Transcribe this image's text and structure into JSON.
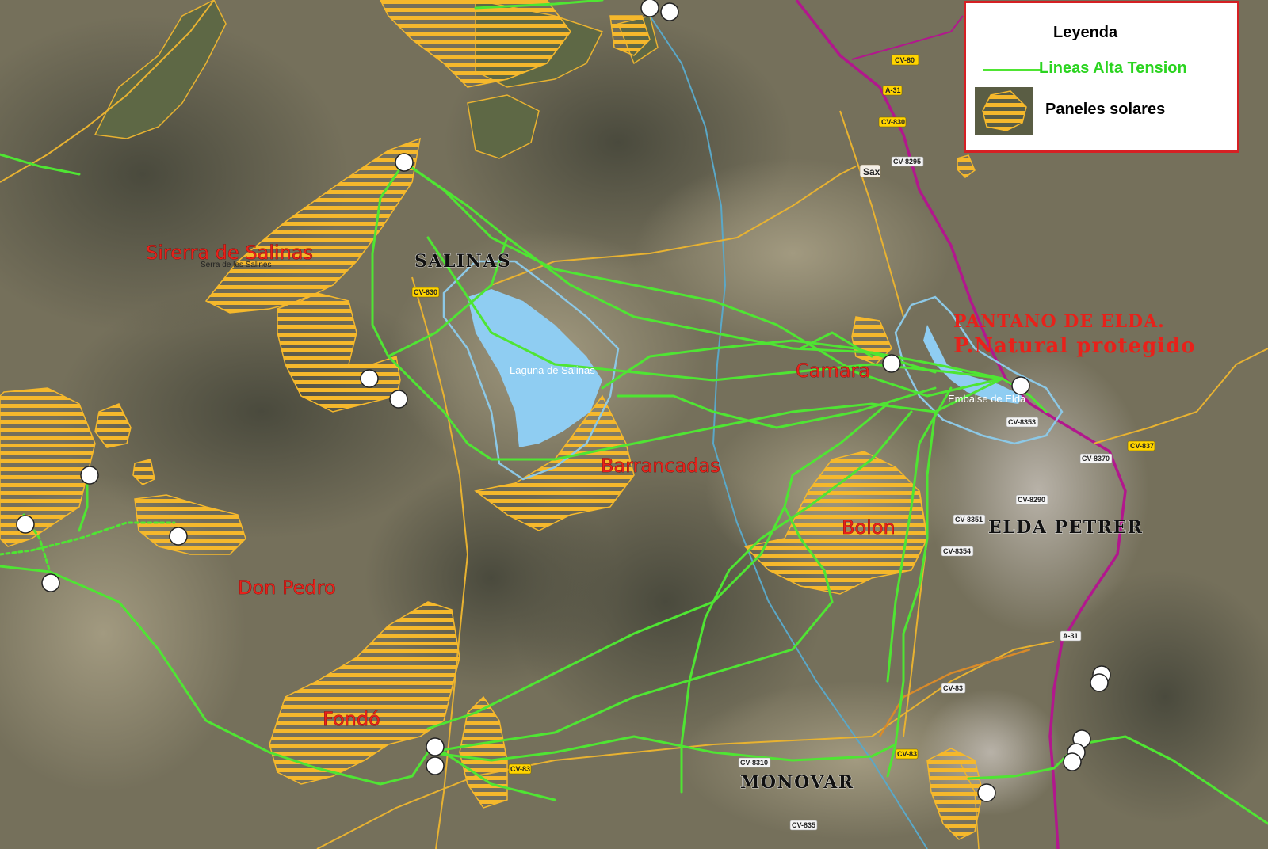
{
  "legend": {
    "title": "Leyenda",
    "hv_label": "Lineas Alta Tension",
    "solar_label": "Paneles solares"
  },
  "colors": {
    "hv_line": "#4fe533",
    "solar_fill": "#f5b82c",
    "legend_border": "#d52024",
    "water": "#8fcdf2",
    "area_label": "#e8211a"
  },
  "map": {
    "labels": {
      "sierra": "Sirerra de Salinas",
      "sierra_small": "Serra de les Salines",
      "salinas": "SALINAS",
      "laguna": "Laguna de Salinas",
      "pantano_1": "PANTANO DE ELDA.",
      "pantano_2": "P.Natural protegido",
      "camara": "Camara",
      "embalse": "Embalse de Elda",
      "barrancadas": "Barrancadas",
      "bolon": "Bolon",
      "elda": "ELDA PETRER",
      "don_pedro": "Don Pedro",
      "fondo": "Fondó",
      "monovar": "MONOVAR",
      "sax": "Sax"
    },
    "roads": {
      "cv80": "CV-80",
      "a31_top": "A-31",
      "cv830_top": "CV-830",
      "cv8295": "CV-8295",
      "cv830_left": "CV-830",
      "cv837": "CV-837",
      "cv8370": "CV-8370",
      "cv8353": "CV-8353",
      "cv8290": "CV-8290",
      "cv8351": "CV-8351",
      "cv8354": "CV-8354",
      "a31_bottom": "A-31",
      "cv83_mid": "CV-83",
      "cv83_bot": "CV-83",
      "cv83_left": "CV-83",
      "cv835": "CV-835",
      "cv8310": "CV-8310"
    }
  }
}
